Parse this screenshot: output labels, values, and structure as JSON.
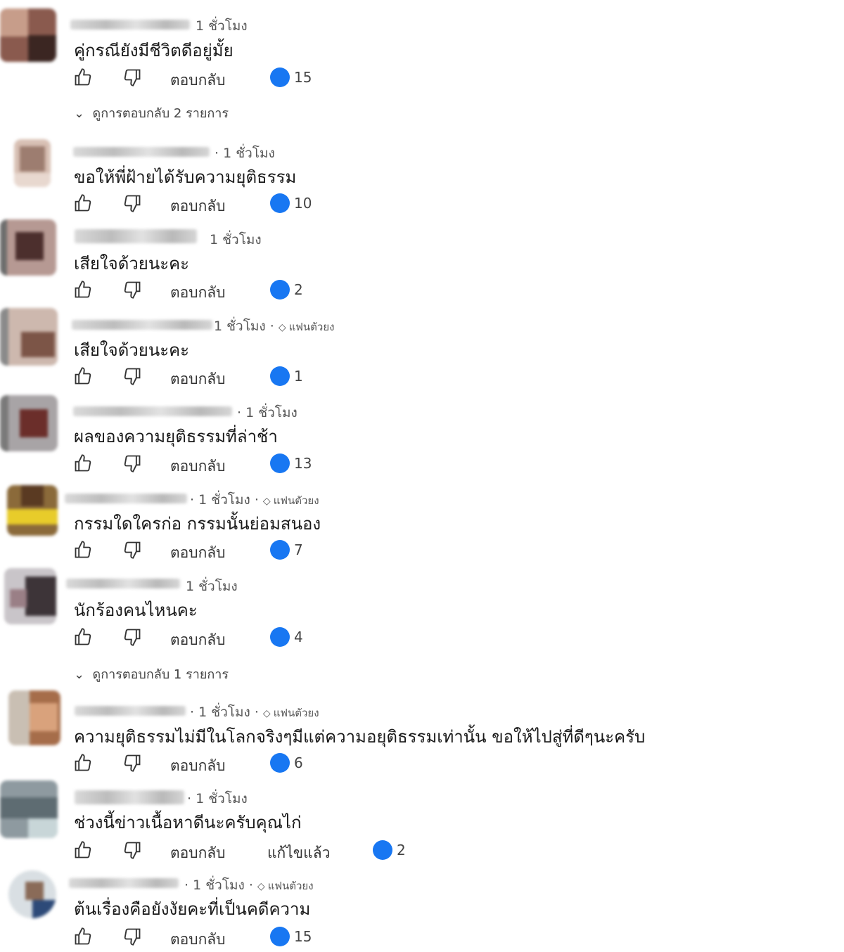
{
  "ui": {
    "reply_label": "ตอบกลับ",
    "fan_badge": "แฟนตัวยง",
    "edited_label": "แก้ไขแล้ว"
  },
  "colors": {
    "like_accent": "#1877f2",
    "text": "#1a1a1a",
    "meta": "#555555"
  },
  "comments": [
    {
      "time": "1 ชั่วโมง",
      "text": "คู่กรณียังมีชีวิตดีอยู่มั้ย",
      "likes": "15",
      "fan": false,
      "edited": false,
      "view_replies": "ดูการตอบกลับ 2 รายการ"
    },
    {
      "time": "1 ชั่วโมง",
      "text": "ขอให้พี่ฝ้ายได้รับความยุติธรรม",
      "likes": "10",
      "fan": false,
      "edited": false
    },
    {
      "time": "1 ชั่วโมง",
      "text": "เสียใจด้วยนะคะ",
      "likes": "2",
      "fan": false,
      "edited": false
    },
    {
      "time": "1 ชั่วโมง",
      "text": "เสียใจด้วยนะคะ",
      "likes": "1",
      "fan": true,
      "edited": false
    },
    {
      "time": "1 ชั่วโมง",
      "text": "ผลของความยุติธรรมที่ล่าช้า",
      "likes": "13",
      "fan": false,
      "edited": false
    },
    {
      "time": "1 ชั่วโมง",
      "text": "กรรมใดใครก่อ กรรมนั้นย่อมสนอง",
      "likes": "7",
      "fan": true,
      "edited": false
    },
    {
      "time": "1 ชั่วโมง",
      "text": "นักร้องคนไหนคะ",
      "likes": "4",
      "fan": false,
      "edited": false,
      "view_replies": "ดูการตอบกลับ 1 รายการ"
    },
    {
      "time": "1 ชั่วโมง",
      "text": "ความยุติธรรมไม่มีในโลกจริงๆมีแต่ความอยุติธรรมเท่านั้น ขอให้ไปสู่ที่ดีๆนะครับ",
      "likes": "6",
      "fan": true,
      "edited": false
    },
    {
      "time": "1 ชั่วโมง",
      "text": "ช่วงนี้ข่าวเนื้อหาดีนะครับคุณไก่",
      "likes": "2",
      "fan": false,
      "edited": true
    },
    {
      "time": "1 ชั่วโมง",
      "text": "ต้นเรื่องคือยังงัยคะที่เป็นคดีความ",
      "likes": "15",
      "fan": true,
      "edited": false
    }
  ]
}
